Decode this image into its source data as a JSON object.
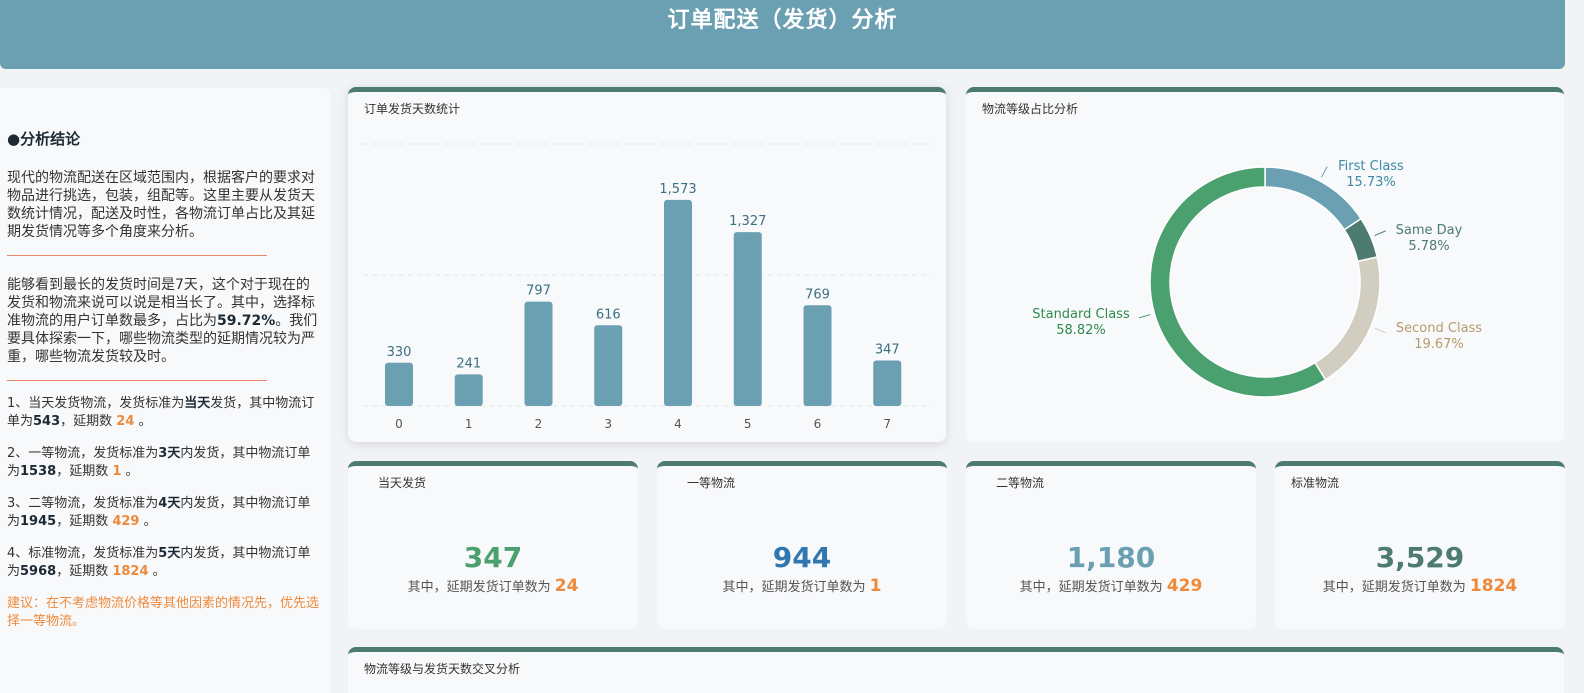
{
  "header": {
    "title": "订单配送（发货）分析"
  },
  "left": {
    "heading": "●分析结论",
    "para1": "现代的物流配送在区域范围内，根据客户的要求对物品进行挑选，包装，组配等。这里主要从发货天数统计情况，配送及时性，各物流订单占比及其延期发货情况等多个角度来分析。",
    "para2_a": "能够看到最长的发货时间是7天，这个对于现在的发货和物流来说可以说是相当长了。其中，选择标准物流的用户订单数最多，占比为",
    "para2_bold": "59.72%",
    "para2_b": "。我们要具体探索一下，哪些物流类型的延期情况较为严重，哪些物流发货较及时。",
    "items": [
      {
        "a": "1、当天发货物流，发货标准为",
        "std": "当天",
        "b": "发货，其中物流订单为",
        "orders": "543",
        "c": "，延期数 ",
        "late": "24",
        "d": " 。"
      },
      {
        "a": "2、一等物流，发货标准为",
        "std": "3天",
        "b": "内发货，其中物流订单为",
        "orders": "1538",
        "c": "，延期数 ",
        "late": "1",
        "d": " 。"
      },
      {
        "a": "3、二等物流，发货标准为",
        "std": "4天",
        "b": "内发货，其中物流订单为",
        "orders": "1945",
        "c": "，延期数 ",
        "late": "429",
        "d": " 。"
      },
      {
        "a": "4、标准物流，发货标准为",
        "std": "5天",
        "b": "内发货，其中物流订单为",
        "orders": "5968",
        "c": "，延期数 ",
        "late": "1824",
        "d": " 。"
      }
    ],
    "advice": "建议：在不考虑物流价格等其他因素的情况先，优先选择一等物流。"
  },
  "bar_card": {
    "title": "订单发货天数统计"
  },
  "donut_card": {
    "title": "物流等级占比分析"
  },
  "bottom_card": {
    "title": "物流等级与发货天数交叉分析"
  },
  "kpis": [
    {
      "title": "当天发货",
      "value": "347",
      "sub": "其中，延期发货订单数为",
      "late": "24",
      "color": "#4aa06e"
    },
    {
      "title": "一等物流",
      "value": "944",
      "sub": "其中，延期发货订单数为",
      "late": "1",
      "color": "#2f77ae"
    },
    {
      "title": "二等物流",
      "value": "1,180",
      "sub": "其中，延期发货订单数为",
      "late": "429",
      "color": "#6aa0b2"
    },
    {
      "title": "标准物流",
      "value": "3,529",
      "sub": "其中，延期发货订单数为",
      "late": "1824",
      "color": "#4d7b70"
    }
  ],
  "chart_data": [
    {
      "type": "bar",
      "title": "订单发货天数统计",
      "categories": [
        "0",
        "1",
        "2",
        "3",
        "4",
        "5",
        "6",
        "7"
      ],
      "values": [
        330,
        241,
        797,
        616,
        1573,
        1327,
        769,
        347
      ],
      "value_labels": [
        "330",
        "241",
        "797",
        "616",
        "1,573",
        "1,327",
        "769",
        "347"
      ],
      "ylim": [
        0,
        2000
      ],
      "grid": true,
      "color": "#6aa0b2"
    },
    {
      "type": "pie",
      "title": "物流等级占比分析",
      "donut": true,
      "labels": [
        "First Class",
        "Same Day",
        "Second Class",
        "Standard Class"
      ],
      "values": [
        15.73,
        5.78,
        19.67,
        58.82
      ],
      "percent_labels": [
        "15.73%",
        "5.78%",
        "19.67%",
        "58.82%"
      ],
      "colors": [
        "#6aa0b2",
        "#4d7b70",
        "#d1cdc0",
        "#4aa06e"
      ],
      "label_colors": [
        "#3c8aa4",
        "#4d7b70",
        "#b59b6b",
        "#2f8a4e"
      ]
    }
  ]
}
